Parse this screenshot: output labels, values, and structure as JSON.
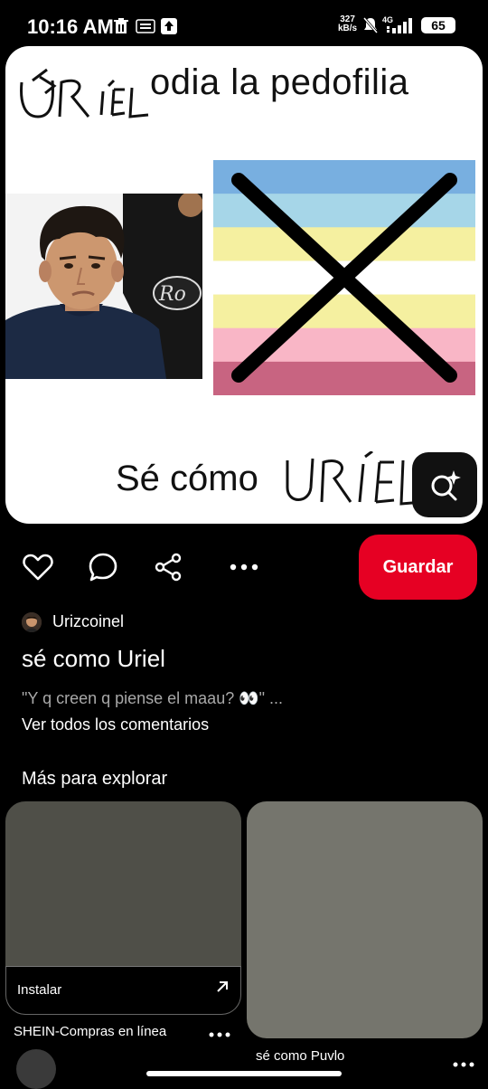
{
  "status_bar": {
    "time": "10:16 AM",
    "speed_value": "327",
    "speed_unit": "kB/s",
    "network": "4G",
    "battery": "65"
  },
  "pin": {
    "title_scrawl": "ÚR IEL",
    "title_text": "odia la pedofilia",
    "caption_text": "Sé cómo",
    "caption_scrawl": "URIEL",
    "shirt_text": "Ro"
  },
  "actions": {
    "save_label": "Guardar"
  },
  "meta": {
    "author": "Urizcoinel",
    "title": "sé como Uriel",
    "comment_preview": "\"Y q creen q piense el maau? 👀\" ...",
    "view_all_comments": "Ver todos los comentarios"
  },
  "explore": {
    "heading": "Más para explorar",
    "cards": [
      {
        "cta": "Instalar",
        "label": "SHEIN-Compras en línea"
      },
      {
        "label": "sé como Puvlo"
      }
    ]
  },
  "colors": {
    "save_red": "#e60023",
    "flag_stripes": [
      "#78afe0",
      "#a6d6e8",
      "#f5f0a0",
      "#ffffff",
      "#f5f0a0",
      "#f9b6c6",
      "#c86481"
    ]
  }
}
